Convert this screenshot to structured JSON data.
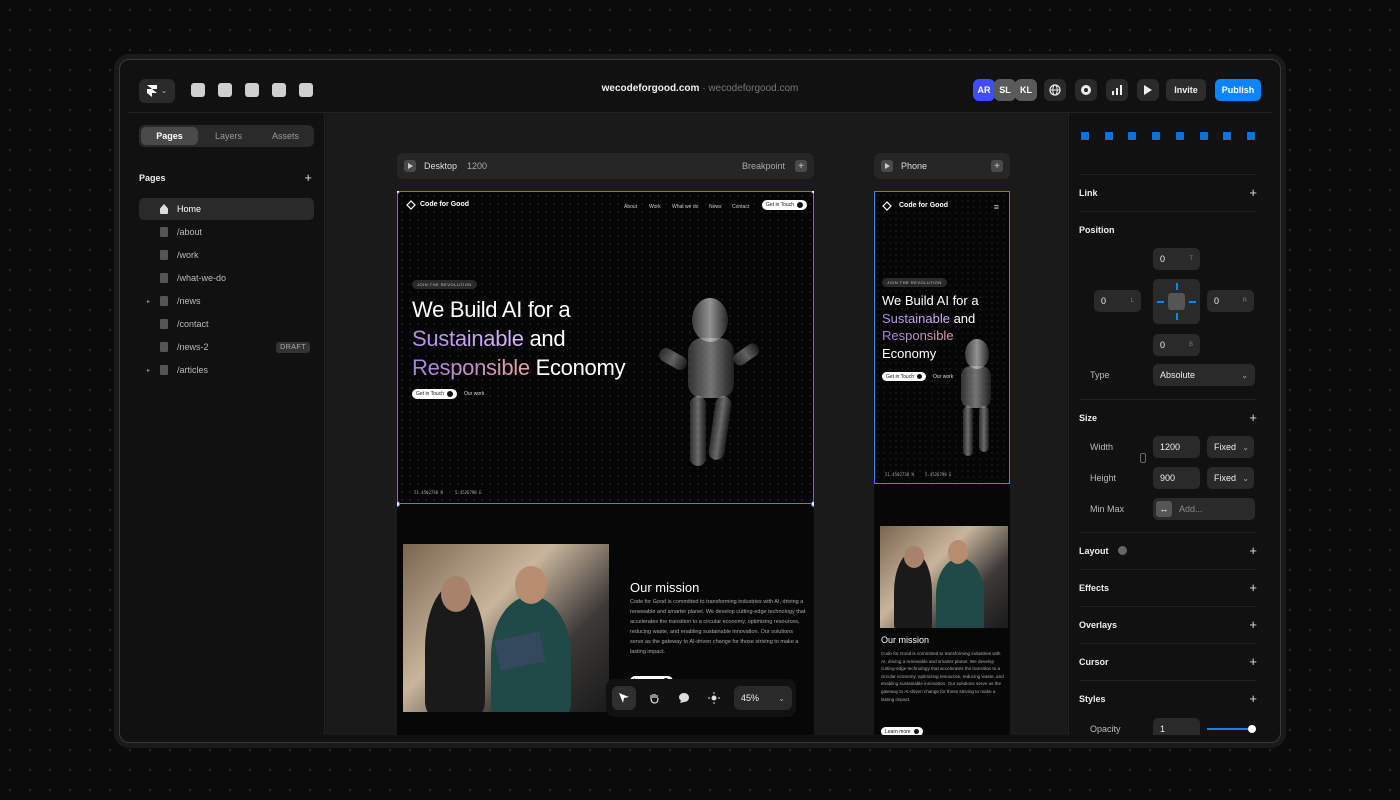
{
  "topbar": {
    "site_main": "wecodeforgood.com",
    "site_sep": "·",
    "site_secondary": "wecodeforgood.com",
    "avatars": [
      {
        "initials": "AR",
        "color": "#3d4cff"
      },
      {
        "initials": "SL",
        "color": "#5a5a5a"
      },
      {
        "initials": "KL",
        "color": "#5a5a5a"
      }
    ],
    "invite_label": "Invite",
    "publish_label": "Publish"
  },
  "left": {
    "tabs": [
      "Pages",
      "Layers",
      "Assets"
    ],
    "pages_heading": "Pages",
    "pages": [
      {
        "label": "Home"
      },
      {
        "label": "/about"
      },
      {
        "label": "/work"
      },
      {
        "label": "/what-we-do"
      },
      {
        "label": "/news"
      },
      {
        "label": "/contact"
      },
      {
        "label": "/news-2",
        "badge": "DRAFT"
      },
      {
        "label": "/articles"
      }
    ]
  },
  "canvas": {
    "desktop_label": "Desktop",
    "desktop_width": "1200",
    "breakpoint_label": "Breakpoint",
    "phone_label": "Phone",
    "site": {
      "logo": "Code for Good",
      "nav": [
        "About",
        "Work",
        "What we do",
        "News",
        "Contact"
      ],
      "cta": "Get in Touch",
      "tag": "JOIN THE REVOLUTION",
      "headline_1": "We Build AI for a",
      "headline_2a": "Sustainable",
      "headline_2b": " and",
      "headline_3a": "Responsible",
      "headline_3b": " Economy",
      "phone_headline_2b": " and",
      "phone_headline_3b": "Economy",
      "btn_primary": "Get in Touch",
      "btn_secondary": "Our work",
      "coord_1": "51.4502738 N",
      "coord_2": "5.4526798 E",
      "mission_heading": "Our mission",
      "mission_text": "Code for Good is committed to transforming industries with AI, driving a renewable and smarter planet. We develop cutting-edge technology that accelerates the transition to a circular economy, optimizing resources, reducing waste, and enabling sustainable innovation. Our solutions serve as the gateway to AI-driven change for those striving to make a lasting impact.",
      "learn_more": "Learn more"
    },
    "zoom": "45%"
  },
  "right": {
    "link_label": "Link",
    "position_label": "Position",
    "pos_top": "0",
    "pos_top_hint": "T",
    "pos_left": "0",
    "pos_left_hint": "L",
    "pos_right": "0",
    "pos_right_hint": "R",
    "pos_bottom": "0",
    "pos_bottom_hint": "B",
    "type_label": "Type",
    "type_value": "Absolute",
    "size_label": "Size",
    "width_label": "Width",
    "width_value": "1200",
    "width_mode": "Fixed",
    "height_label": "Height",
    "height_value": "900",
    "height_mode": "Fixed",
    "minmax_label": "Min Max",
    "minmax_placeholder": "Add...",
    "layout_label": "Layout",
    "effects_label": "Effects",
    "overlays_label": "Overlays",
    "cursor_label": "Cursor",
    "styles_label": "Styles",
    "opacity_label": "Opacity",
    "opacity_value": "1"
  }
}
